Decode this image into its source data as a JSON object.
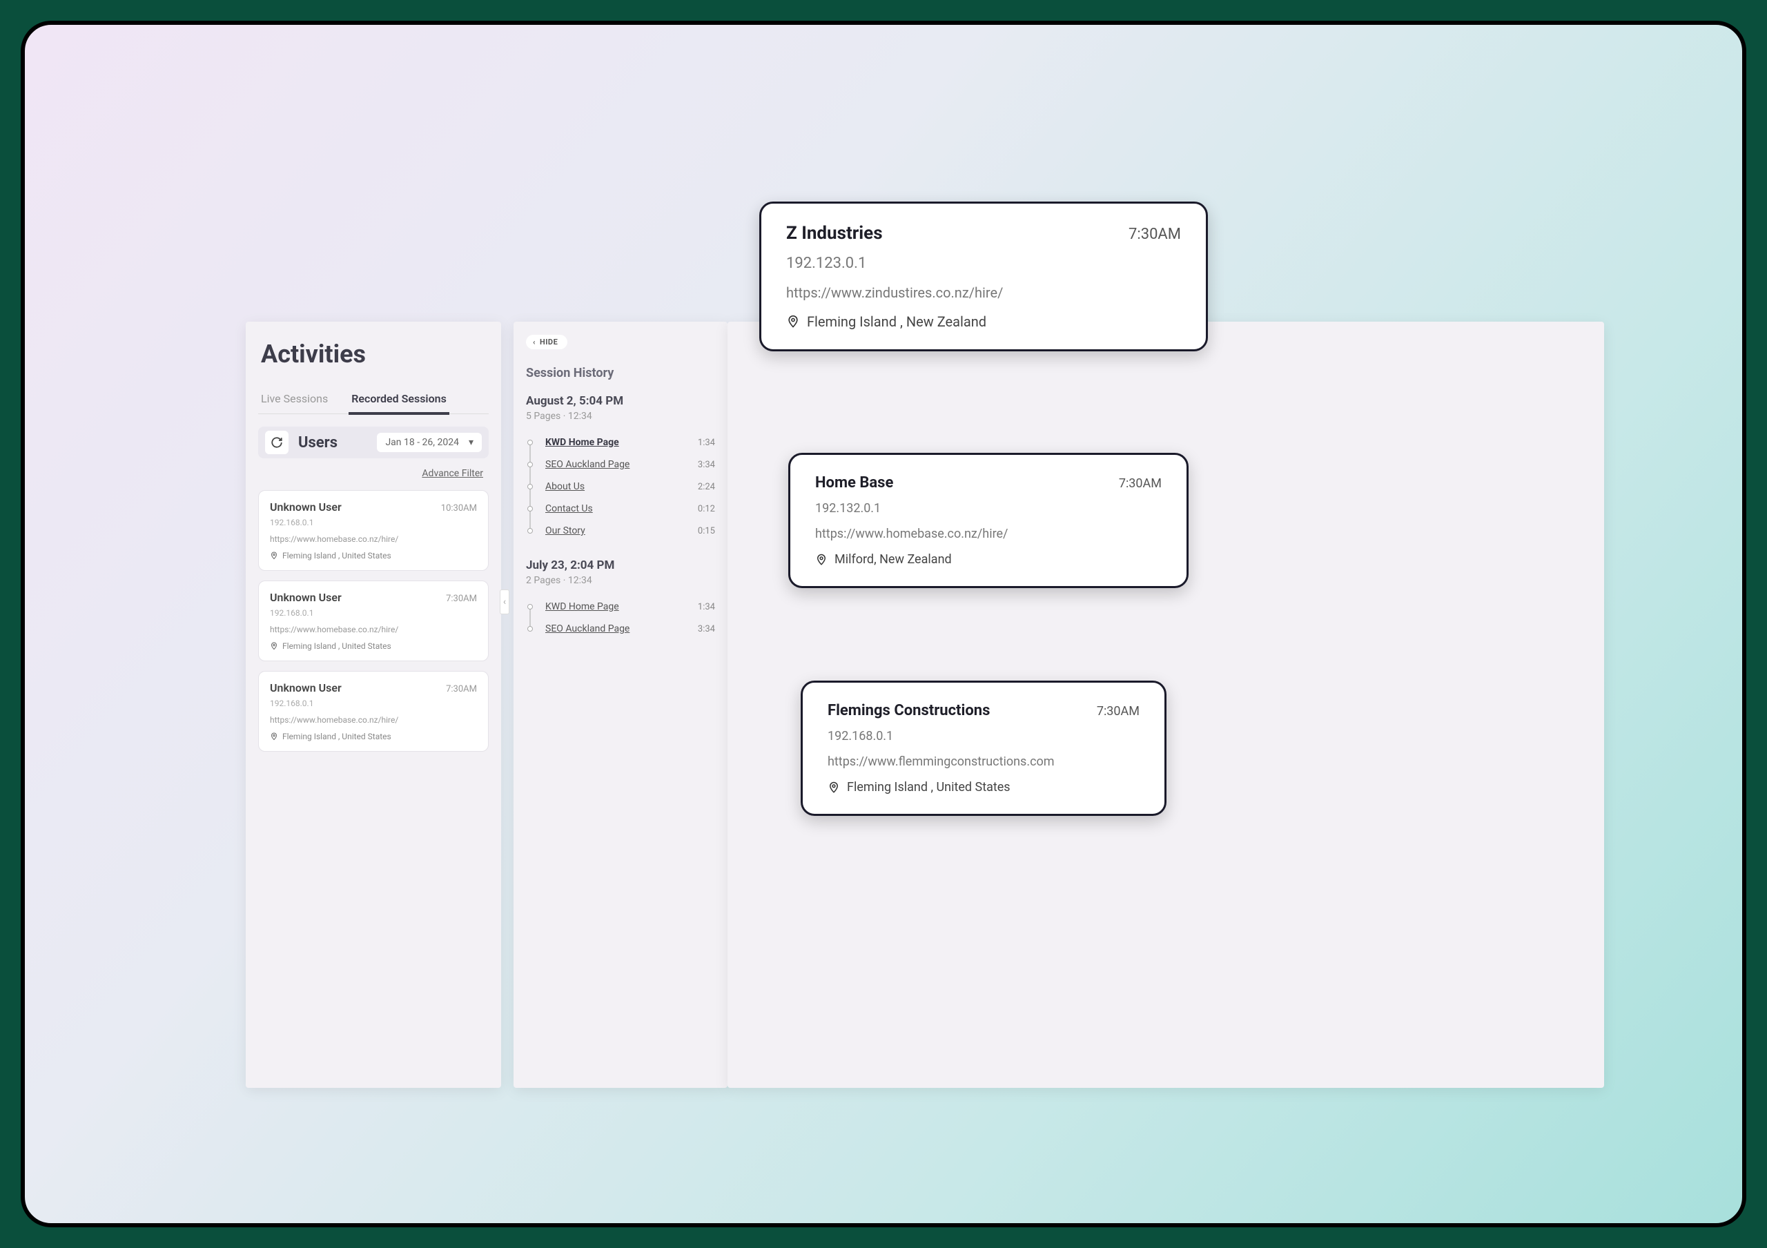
{
  "activities": {
    "title": "Activities",
    "tabs": {
      "live": "Live Sessions",
      "recorded": "Recorded Sessions"
    },
    "users_label": "Users",
    "date_filter": "Jan 18 - 26, 2024",
    "advance_filter": "Advance Filter",
    "sessions": [
      {
        "name": "Unknown User",
        "time": "10:30AM",
        "ip": "192.168.0.1",
        "url": "https://www.homebase.co.nz/hire/",
        "loc": "Fleming Island , United States"
      },
      {
        "name": "Unknown User",
        "time": "7:30AM",
        "ip": "192.168.0.1",
        "url": "https://www.homebase.co.nz/hire/",
        "loc": "Fleming Island , United States"
      },
      {
        "name": "Unknown User",
        "time": "7:30AM",
        "ip": "192.168.0.1",
        "url": "https://www.homebase.co.nz/hire/",
        "loc": "Fleming Island , United States"
      }
    ]
  },
  "history": {
    "hide_label": "HIDE",
    "title": "Session History",
    "groups": [
      {
        "date": "August 2, 5:04 PM",
        "sub": "5 Pages · 12:34",
        "items": [
          {
            "label": "KWD Home Page",
            "dur": "1:34",
            "bold": true
          },
          {
            "label": "SEO Auckland Page",
            "dur": "3:34"
          },
          {
            "label": "About Us",
            "dur": "2:24"
          },
          {
            "label": "Contact Us",
            "dur": "0:12"
          },
          {
            "label": "Our Story",
            "dur": "0:15"
          }
        ]
      },
      {
        "date": "July 23, 2:04 PM",
        "sub": "2 Pages · 12:34",
        "items": [
          {
            "label": "KWD Home Page",
            "dur": "1:34"
          },
          {
            "label": "SEO Auckland Page",
            "dur": "3:34"
          }
        ]
      }
    ]
  },
  "cards": [
    {
      "name": "Z Industries",
      "time": "7:30AM",
      "ip": "192.123.0.1",
      "url": "https://www.zindustires.co.nz/hire/",
      "loc": "Fleming Island , New Zealand"
    },
    {
      "name": "Home Base",
      "time": "7:30AM",
      "ip": "192.132.0.1",
      "url": "https://www.homebase.co.nz/hire/",
      "loc": "Milford, New Zealand"
    },
    {
      "name": "Flemings Constructions",
      "time": "7:30AM",
      "ip": "192.168.0.1",
      "url": "https://www.flemmingconstructions.com",
      "loc": "Fleming Island , United States"
    }
  ]
}
